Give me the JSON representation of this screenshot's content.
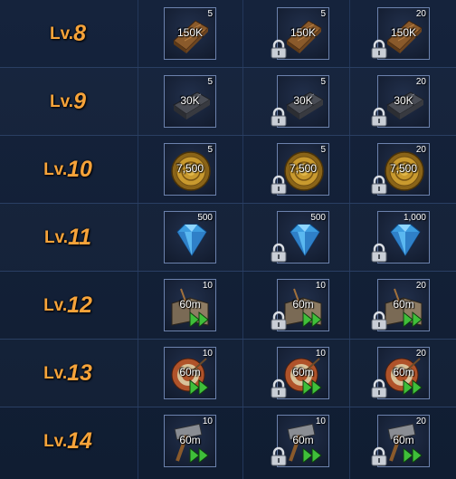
{
  "rows": [
    {
      "level_prefix": "Lv.",
      "level_number": "8",
      "icon": "wood-planks-icon",
      "value": "150K",
      "quantities": [
        "5",
        "5",
        "20"
      ]
    },
    {
      "level_prefix": "Lv.",
      "level_number": "9",
      "icon": "iron-ingot-icon",
      "value": "30K",
      "quantities": [
        "5",
        "5",
        "20"
      ]
    },
    {
      "level_prefix": "Lv.",
      "level_number": "10",
      "icon": "gold-coin-icon",
      "value": "7,500",
      "quantities": [
        "5",
        "5",
        "20"
      ]
    },
    {
      "level_prefix": "Lv.",
      "level_number": "11",
      "icon": "gem-icon",
      "value": "",
      "quantities": [
        "500",
        "500",
        "1,000"
      ]
    },
    {
      "level_prefix": "Lv.",
      "level_number": "12",
      "icon": "research-speedup-icon",
      "value": "60m",
      "quantities": [
        "10",
        "10",
        "20"
      ]
    },
    {
      "level_prefix": "Lv.",
      "level_number": "13",
      "icon": "training-speedup-icon",
      "value": "60m",
      "quantities": [
        "10",
        "10",
        "20"
      ]
    },
    {
      "level_prefix": "Lv.",
      "level_number": "14",
      "icon": "building-speedup-icon",
      "value": "60m",
      "quantities": [
        "10",
        "10",
        "20"
      ]
    }
  ],
  "lock_icon": "padlock-icon",
  "colors": {
    "level_text": "#f6a33a",
    "cell_border": "#6c82ad",
    "background": "#101d32",
    "speedup_arrow": "#3fbf3a"
  }
}
